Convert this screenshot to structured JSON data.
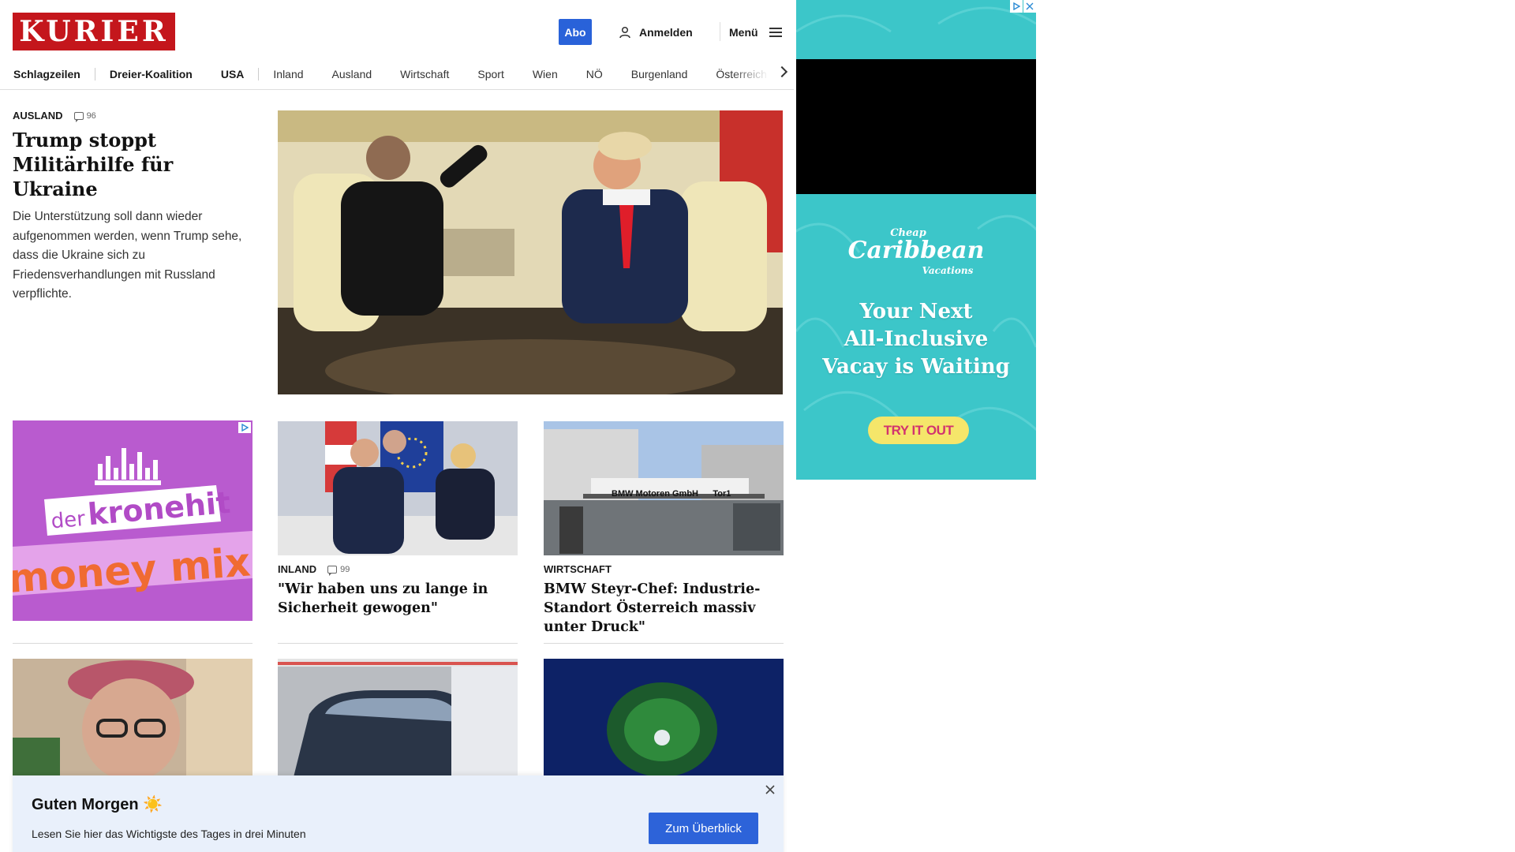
{
  "header": {
    "logo_text": "KURIER",
    "abo_label": "Abo",
    "login_label": "Anmelden",
    "menu_label": "Menü"
  },
  "nav": {
    "items": [
      {
        "label": "Schlagzeilen",
        "bold": true
      },
      {
        "label": "Dreier-Koalition",
        "bold": true
      },
      {
        "label": "USA",
        "bold": true
      },
      {
        "label": "Inland",
        "bold": false
      },
      {
        "label": "Ausland",
        "bold": false
      },
      {
        "label": "Wirtschaft",
        "bold": false
      },
      {
        "label": "Sport",
        "bold": false
      },
      {
        "label": "Wien",
        "bold": false
      },
      {
        "label": "NÖ",
        "bold": false
      },
      {
        "label": "Burgenland",
        "bold": false
      },
      {
        "label": "Österreich",
        "bold": false
      }
    ]
  },
  "lead": {
    "kicker": "AUSLAND",
    "comments": "96",
    "title": "Trump stoppt Militärhilfe für Ukraine",
    "teaser": "Die Unterstützung soll dann wieder aufgenommen werden, wenn Trump sehe, dass die Ukraine sich zu Friedensverhandlungen mit Russland verpflichte."
  },
  "promo": {
    "brand_prefix": "der",
    "brand_name": "kronehit",
    "tagline": "money mix"
  },
  "cards": [
    {
      "kicker": "INLAND",
      "comments": "99",
      "title": "\"Wir haben uns zu lange in Sicherheit gewogen\""
    },
    {
      "kicker": "WIRTSCHAFT",
      "comments": "",
      "title": "BMW Steyr-Chef: Industrie-Standort Österreich massiv unter Druck\"",
      "image_sign": "BMW Motoren GmbH      Tor1"
    }
  ],
  "banner": {
    "title": "Guten Morgen ☀️",
    "subtitle": "Lesen Sie hier das Wichtigste des Tages in drei Minuten",
    "button_label": "Zum Überblick"
  },
  "side_ad": {
    "brand_small": "Cheap",
    "brand_main": "Caribbean",
    "brand_sub": "Vacations",
    "headline_lines": [
      "Your Next",
      "All-Inclusive",
      "Vacay is Waiting"
    ],
    "cta": "TRY IT OUT"
  },
  "colors": {
    "brand_red": "#c4161c",
    "accent_blue": "#2962d9",
    "banner_bg": "#e9f0fb",
    "promo_purple": "#b95bcf",
    "ad_teal": "#3cc6c9"
  }
}
